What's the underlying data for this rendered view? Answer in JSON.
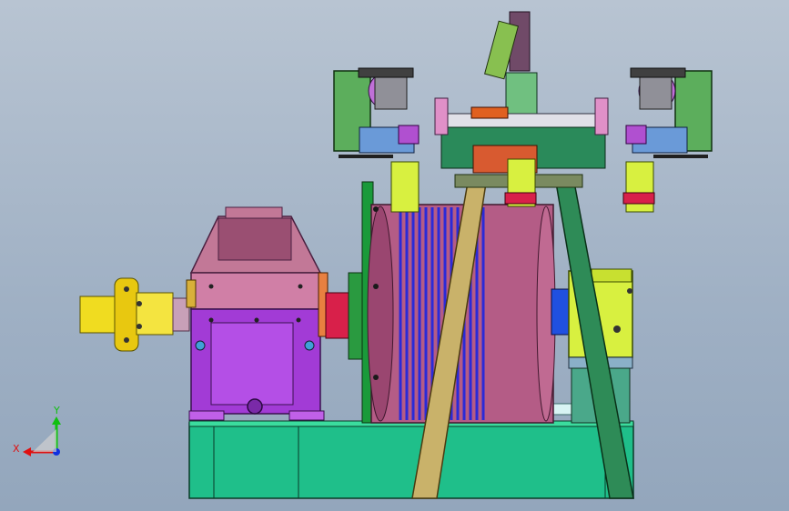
{
  "viewport": {
    "model_name": "winch-assembly-3d-model",
    "background_top": "#b8c4d2",
    "background_bottom": "#93a6bc"
  },
  "triad": {
    "x_label": "X",
    "y_label": "Y",
    "x_color": "#e01010",
    "y_color": "#10c010",
    "z_color": "#1030e0"
  },
  "colors": {
    "gearbox": "#a23bd6",
    "gearbox_top": "#c27897",
    "drum": "#b45c86",
    "rope": "#2a2ad8",
    "frame": "#24b07a",
    "shaft": "#f0dc20",
    "brace": "#c9b26a",
    "brace_green": "#2e8b57",
    "motor_green": "#5cae5c",
    "clamp_yellow": "#d8f040",
    "bearing_red": "#d8204a"
  }
}
